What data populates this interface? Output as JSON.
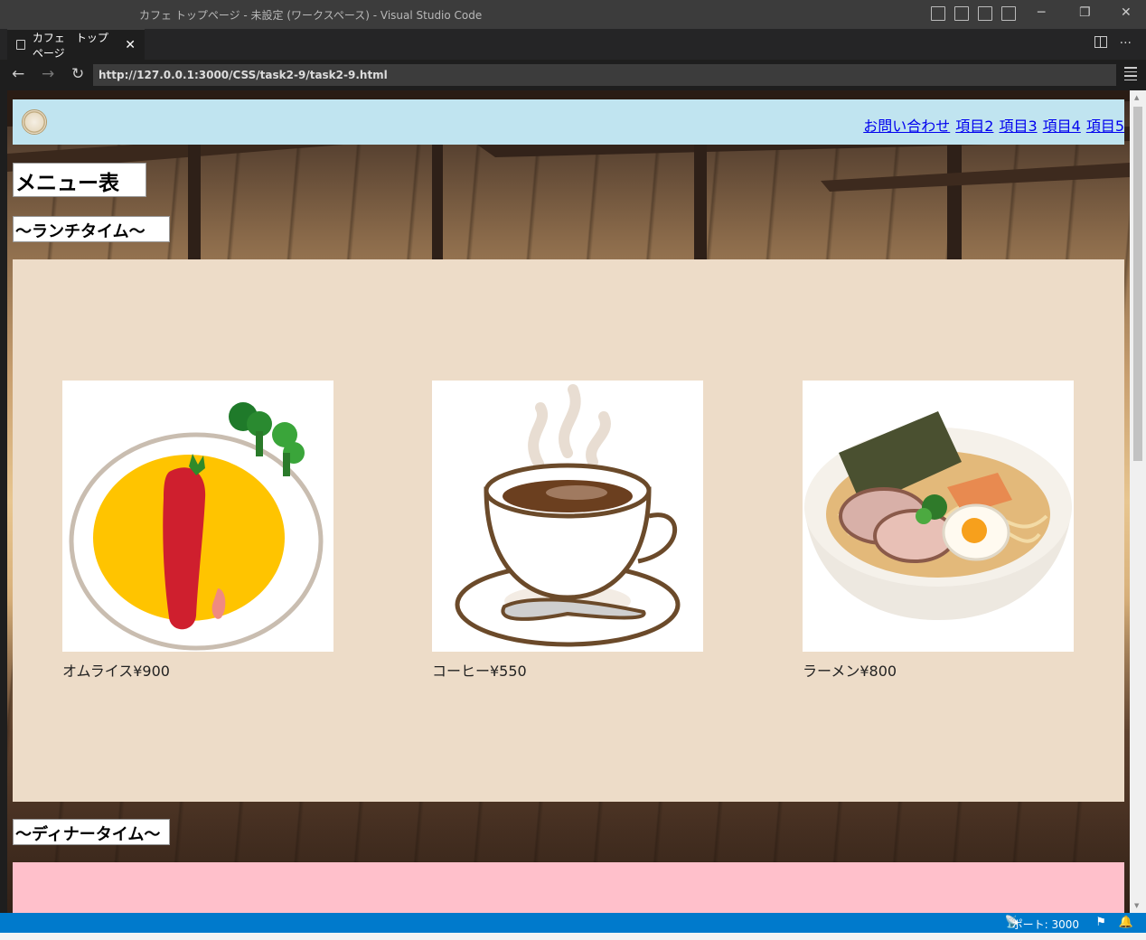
{
  "window": {
    "title": "カフェ トップページ - 未設定 (ワークスペース) - Visual Studio Code",
    "minimize": "─",
    "restore": "❐",
    "close": "✕"
  },
  "tab": {
    "label": "カフェ　トップページ",
    "close": "✕",
    "more": "···"
  },
  "browser": {
    "back": "←",
    "forward": "→",
    "reload": "↻",
    "url": "http://127.0.0.1:3000/CSS/task2-9/task2-9.html"
  },
  "site": {
    "nav": [
      "お問い合わせ",
      "項目2",
      "項目3",
      "項目4",
      "項目5"
    ],
    "menu_heading": "メニュー表",
    "lunch_heading": "〜ランチタイム〜",
    "dinner_heading": "〜ディナータイム〜",
    "lunch_items": [
      {
        "caption": "オムライス¥900",
        "image": "omurice-illustration"
      },
      {
        "caption": "コーヒー¥550",
        "image": "coffee-illustration"
      },
      {
        "caption": "ラーメン¥800",
        "image": "ramen-illustration"
      }
    ],
    "colors": {
      "header_bg": "#c0e4f0",
      "lunch_bg": "#eddcc8",
      "dinner_bg": "#ffc0cb",
      "link": "#0000ee"
    }
  },
  "statusbar": {
    "port": "ポート: 3000",
    "icons": [
      "broadcast-icon",
      "feedback-icon",
      "bell-icon"
    ]
  }
}
